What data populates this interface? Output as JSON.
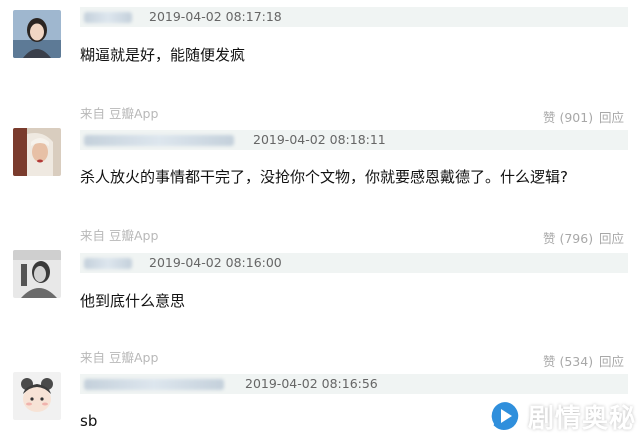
{
  "comments": [
    {
      "timestamp": "2019-04-02 08:17:18",
      "text": "糊逼就是好，能随便发疯",
      "source_prefix": "来自",
      "source_app": "豆瓣App",
      "vote_label": "赞 (901)",
      "reply_label": "回应"
    },
    {
      "timestamp": "2019-04-02 08:18:11",
      "text": "杀人放火的事情都干完了，没抢你个文物，你就要感恩戴德了。什么逻辑?",
      "source_prefix": "来自",
      "source_app": "豆瓣App",
      "vote_label": "赞 (796)",
      "reply_label": "回应"
    },
    {
      "timestamp": "2019-04-02 08:16:00",
      "text": "他到底什么意思",
      "source_prefix": "来自",
      "source_app": "豆瓣App",
      "vote_label": "赞 (534)",
      "reply_label": "回应"
    },
    {
      "timestamp": "2019-04-02 08:16:56",
      "text": "sb"
    }
  ],
  "watermark": {
    "text": "剧情奥秘",
    "logo_icon": "play-bubble-icon",
    "color": "#2f8fdc"
  }
}
